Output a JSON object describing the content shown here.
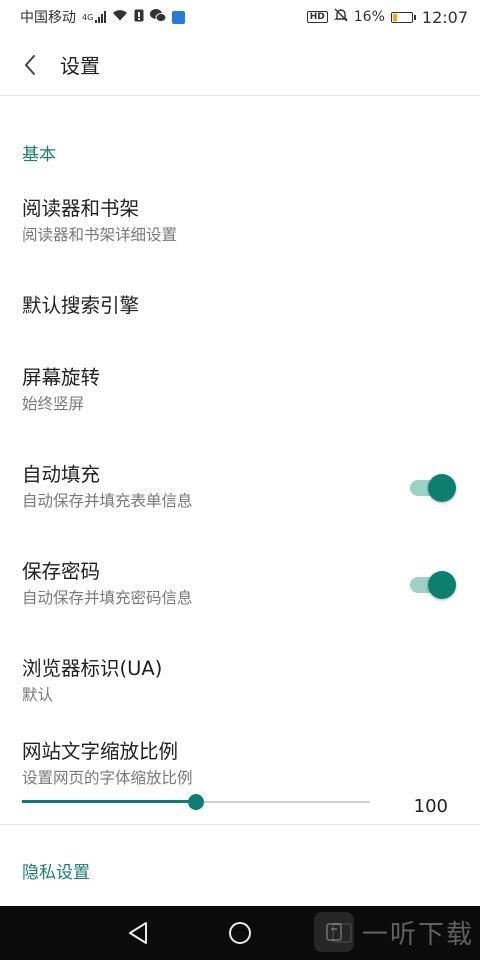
{
  "status_bar": {
    "carrier": "中国移动",
    "network": "4G",
    "hd_badge": "HD",
    "battery_percent": "16%",
    "battery_level": 0.16,
    "time": "12:07",
    "icons": [
      "signal-icon",
      "wifi-icon",
      "notification-icon",
      "wechat-icon",
      "app-icon",
      "mute-icon",
      "battery-icon"
    ]
  },
  "appbar": {
    "back_icon": "chevron-left-icon",
    "title": "设置"
  },
  "sections": {
    "basic": {
      "title": "基本"
    },
    "privacy": {
      "title": "隐私设置"
    }
  },
  "items": {
    "reader": {
      "title": "阅读器和书架",
      "subtitle": "阅读器和书架详细设置"
    },
    "search_engine": {
      "title": "默认搜索引擎"
    },
    "rotation": {
      "title": "屏幕旋转",
      "subtitle": "始终竖屏"
    },
    "autofill": {
      "title": "自动填充",
      "subtitle": "自动保存并填充表单信息",
      "enabled": true
    },
    "save_password": {
      "title": "保存密码",
      "subtitle": "自动保存并填充密码信息",
      "enabled": true
    },
    "user_agent": {
      "title": "浏览器标识(UA)",
      "subtitle": "默认"
    },
    "text_scale": {
      "title": "网站文字缩放比例",
      "subtitle": "设置网页的字体缩放比例",
      "value": "100",
      "fraction": 0.5
    }
  },
  "nav_bar": {
    "buttons": [
      "back-triangle-icon",
      "home-circle-icon",
      "recents-square-icon"
    ]
  },
  "watermark": {
    "text": "一听下载"
  },
  "colors": {
    "accent": "#0d7f71",
    "accent_light": "#9dd2c6",
    "section_text": "#1e7f73"
  }
}
